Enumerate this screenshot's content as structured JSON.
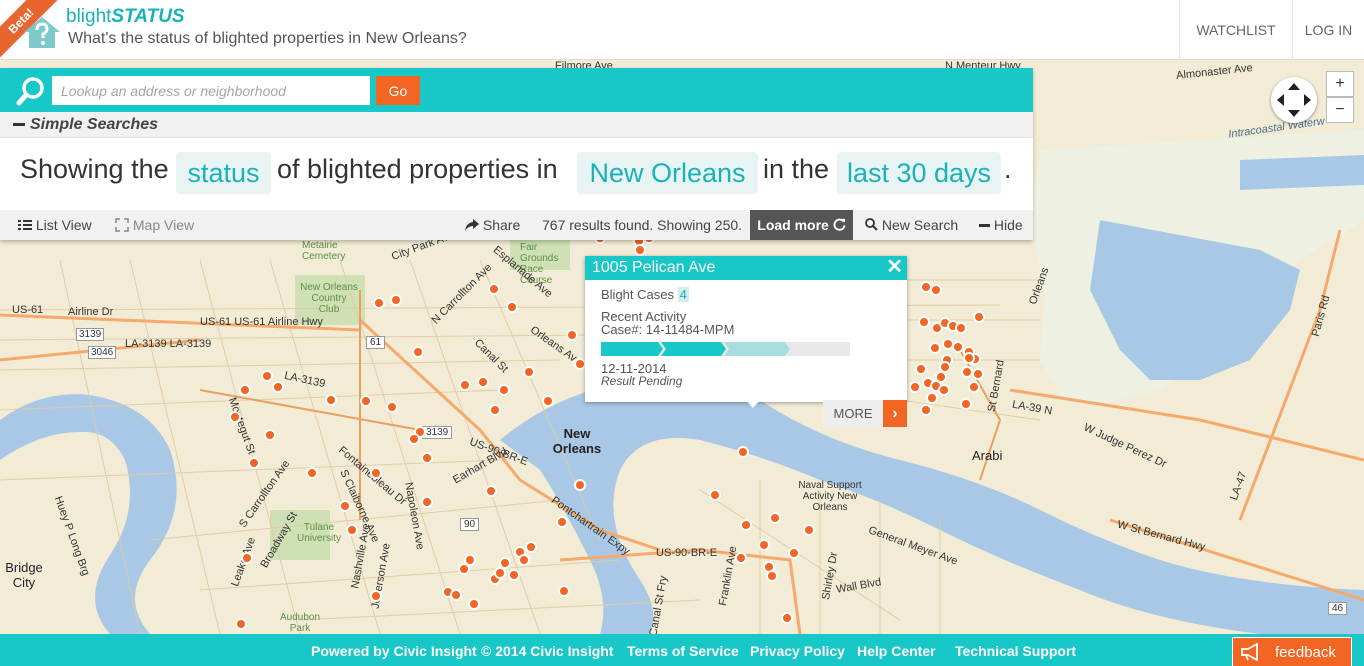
{
  "header": {
    "beta_label": "Beta!",
    "brand_prefix": "blight",
    "brand_suffix": "STATUS",
    "tagline": "What's the status of blighted properties in New Orleans?",
    "watchlist": "WATCHLIST",
    "login": "LOG IN"
  },
  "search": {
    "placeholder": "Lookup an address or neighborhood",
    "go_label": "Go",
    "simple_searches_label": "Simple Searches"
  },
  "sentence": {
    "prefix": "Showing the",
    "status_choice": "status",
    "middle": "of blighted properties in",
    "location_choice": "New Orleans",
    "in_the": "in the",
    "period_choice": "last 30 days",
    "end": "."
  },
  "toolbar": {
    "list_view": "List View",
    "map_view": "Map View",
    "share": "Share",
    "results_text": "767 results found. Showing 250.",
    "load_more": "Load more",
    "new_search": "New Search",
    "hide": "Hide"
  },
  "popup": {
    "address": "1005 Pelican Ave",
    "close_glyph": "✕",
    "blight_cases_label": "Blight Cases",
    "blight_cases_count": "4",
    "recent_activity_label": "Recent Activity",
    "case_number": "Case#: 14-11484-MPM",
    "date": "12-11-2014",
    "result": "Result Pending",
    "progress_steps_complete": 3,
    "progress_steps_total": 4,
    "more_label": "MORE",
    "more_arrow": "›"
  },
  "map": {
    "zoom_in": "+",
    "zoom_out": "−",
    "labels": [
      "Filmore Ave",
      "N Menteur Hwy",
      "Almonaster Ave",
      "Intracoastal Waterw",
      "Metairie Cemetery",
      "City Park Ave",
      "Fair Grounds Race Course",
      "New Orleans Country Club",
      "US-61",
      "Airline Dr",
      "3139",
      "US-61 US-61 Airline Hwy",
      "3046",
      "LA-3139 LA-3139",
      "61",
      "LA-3139",
      "Canal St",
      "Orleans Ave",
      "N Carrollton Ave",
      "Esplanade Ave",
      "New Orleans",
      "US-90-BR-E",
      "Earhart Blvd",
      "Fontainebleau Dr",
      "S Carrollton Ave",
      "S Claiborne Ave",
      "Napoleon Ave",
      "Tulane University",
      "Audubon Park",
      "Bridge City",
      "Huey P Long Brg",
      "Jefferson Ave",
      "Nashville Ave",
      "Broadway St",
      "Leake Ave",
      "US-90-BR-E",
      "Franklin Ave",
      "Naval Support Activity New Orleans",
      "Shirley Dr",
      "Wall Blvd",
      "General Meyer Ave",
      "W St Bernard Hwy",
      "W Judge Perez Dr",
      "LA-39 N",
      "Arabi",
      "St Bernard",
      "LA-47",
      "Paris Rd",
      "Orleans",
      "46",
      "90",
      "3139",
      "Pontchartrain Expy",
      "Montegut St",
      "Canal St Fry"
    ]
  },
  "footer": {
    "powered_by": "Powered by Civic Insight",
    "copyright": "© 2014 Civic Insight",
    "terms": "Terms of Service",
    "privacy": "Privacy Policy",
    "help": "Help Center",
    "support": "Technical Support",
    "feedback": "feedback"
  },
  "colors": {
    "accent_teal": "#18c7c8",
    "brand_teal": "#19b2b7",
    "orange": "#f26522",
    "water": "#a9c8e6",
    "land": "#f2ecd6"
  },
  "icons": [
    "house-question-icon",
    "search-icon",
    "list-icon",
    "expand-icon",
    "share-icon",
    "refresh-icon",
    "magnifier-icon",
    "minus-icon",
    "close-icon",
    "chevron-right-icon",
    "navigation-compass-icon",
    "megaphone-icon"
  ]
}
